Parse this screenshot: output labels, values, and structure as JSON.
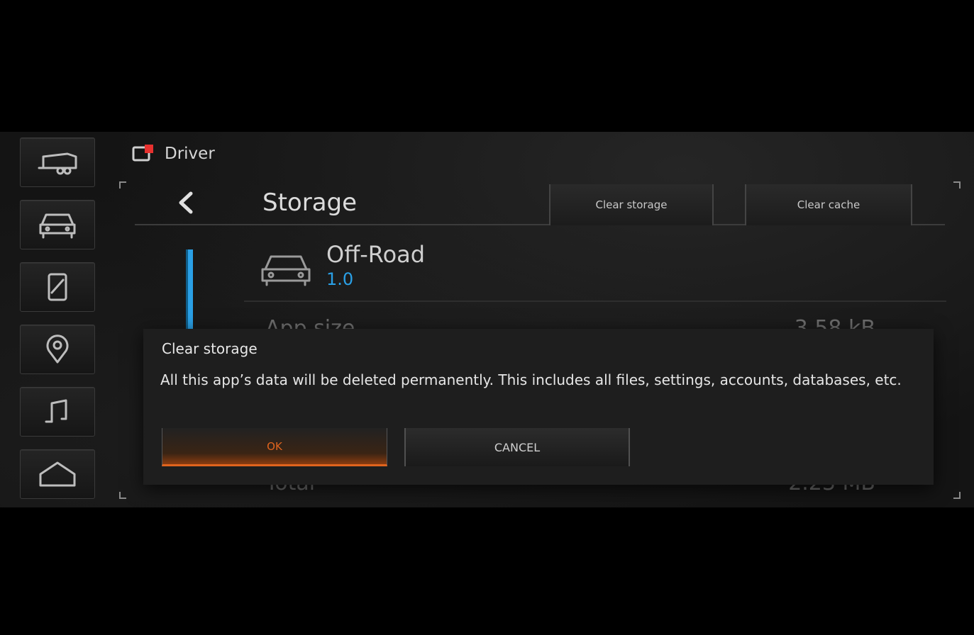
{
  "status_bar": {
    "profile_label": "Driver",
    "profile_icon": "driver-profile-icon"
  },
  "dock": {
    "items": [
      {
        "icon": "trailer-icon"
      },
      {
        "icon": "vehicle-icon"
      },
      {
        "icon": "phone-icon"
      },
      {
        "icon": "navigation-pin-icon"
      },
      {
        "icon": "music-note-icon"
      },
      {
        "icon": "home-icon"
      }
    ]
  },
  "storage": {
    "title": "Storage",
    "back_icon": "chevron-left-icon",
    "clear_storage_label": "Clear storage",
    "clear_cache_label": "Clear cache",
    "app": {
      "name": "Off-Road",
      "version": "1.0",
      "icon": "vehicle-icon"
    },
    "rows": {
      "app_size_label": "App size",
      "app_size_value": "3.58 kB",
      "total_label": "Total",
      "total_value": "2.23 MB"
    }
  },
  "dialog": {
    "title": "Clear storage",
    "message": "All this app’s data will be deleted permanently. This includes all files, settings, accounts, databases, etc.",
    "ok_label": "OK",
    "cancel_label": "CANCEL"
  },
  "colors": {
    "accent_blue": "#2aa0e6",
    "accent_orange": "#e0641e",
    "profile_red": "#e8312f"
  }
}
